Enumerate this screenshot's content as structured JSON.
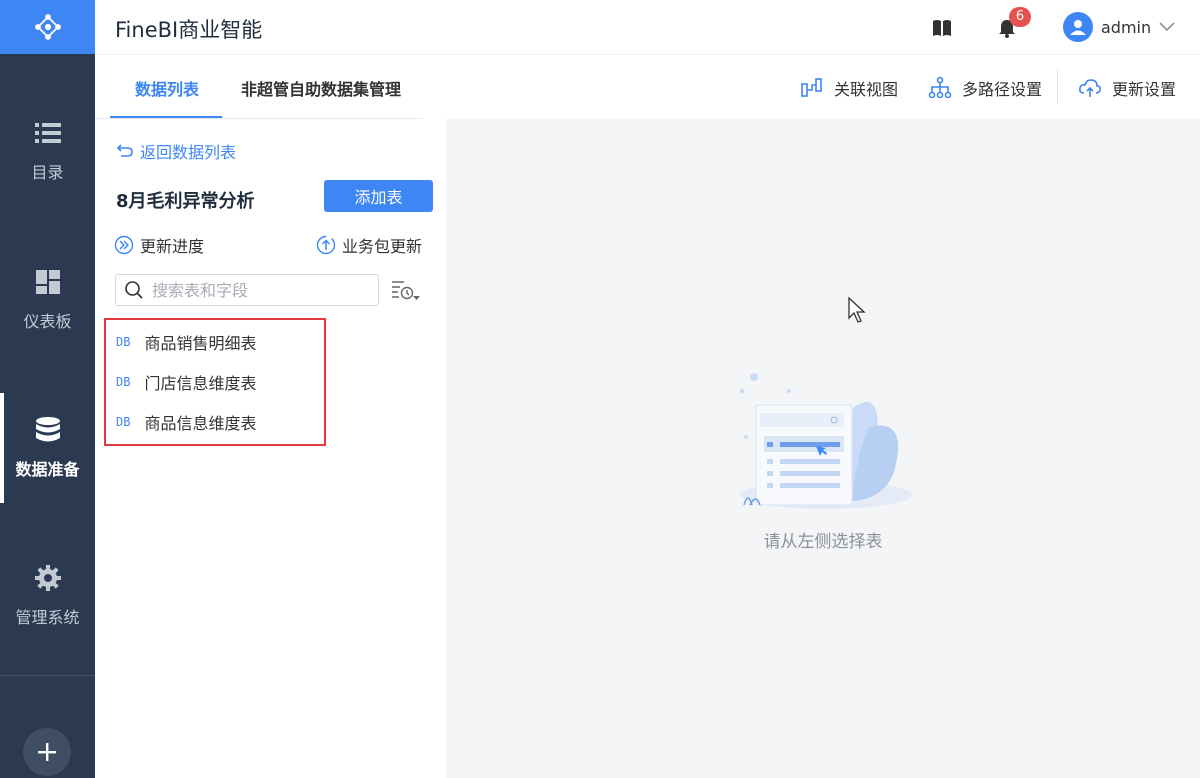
{
  "header": {
    "app_title": "FineBI商业智能",
    "notification_count": "6",
    "username": "admin"
  },
  "sidebar": {
    "items": [
      {
        "label": "目录",
        "icon": "list-icon"
      },
      {
        "label": "仪表板",
        "icon": "dashboard-icon"
      },
      {
        "label": "数据准备",
        "icon": "database-icon",
        "active": true
      },
      {
        "label": "管理系统",
        "icon": "gear-icon"
      }
    ]
  },
  "tabs": [
    {
      "label": "数据列表",
      "active": true
    },
    {
      "label": "非超管自助数据集管理"
    }
  ],
  "toolbar": {
    "relation_view": "关联视图",
    "multi_path": "多路径设置",
    "update_settings": "更新设置"
  },
  "panel": {
    "back_label": "返回数据列表",
    "package_title": "8月毛利异常分析",
    "add_table_label": "添加表",
    "update_progress": "更新进度",
    "package_update": "业务包更新",
    "search_placeholder": "搜索表和字段",
    "tables": [
      {
        "badge": "DB",
        "name": "商品销售明细表"
      },
      {
        "badge": "DB",
        "name": "门店信息维度表"
      },
      {
        "badge": "DB",
        "name": "商品信息维度表"
      }
    ]
  },
  "content": {
    "empty_text": "请从左侧选择表"
  },
  "colors": {
    "accent": "#3e86f3",
    "sidebar_bg": "#2b3a50",
    "highlight_box": "#e3383d",
    "badge": "#e65251"
  }
}
